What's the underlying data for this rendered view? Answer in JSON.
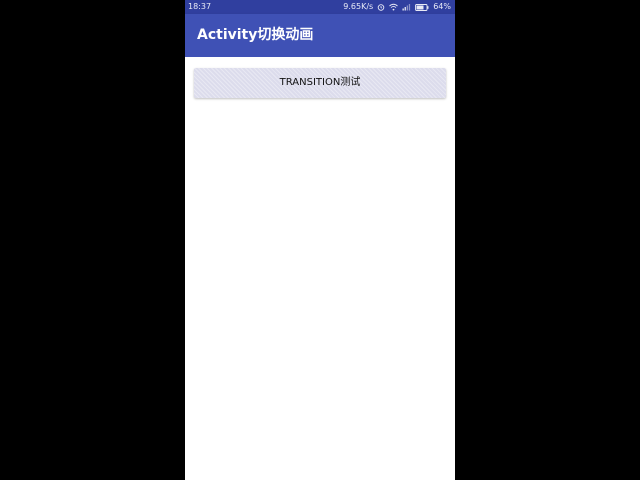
{
  "status_bar": {
    "time": "18:37",
    "network_speed": "9.65K/s",
    "battery_percent": "64%",
    "icons": [
      "alarm-icon",
      "wifi-icon",
      "signal-icon",
      "battery-icon"
    ]
  },
  "app_bar": {
    "title": "Activity切换动画",
    "color": "#3f51b5"
  },
  "main": {
    "button_label": "TRANSITION测试"
  },
  "colors": {
    "status_bar": "#303f9f",
    "primary": "#3f51b5",
    "background": "#ffffff",
    "outside": "#000000"
  }
}
